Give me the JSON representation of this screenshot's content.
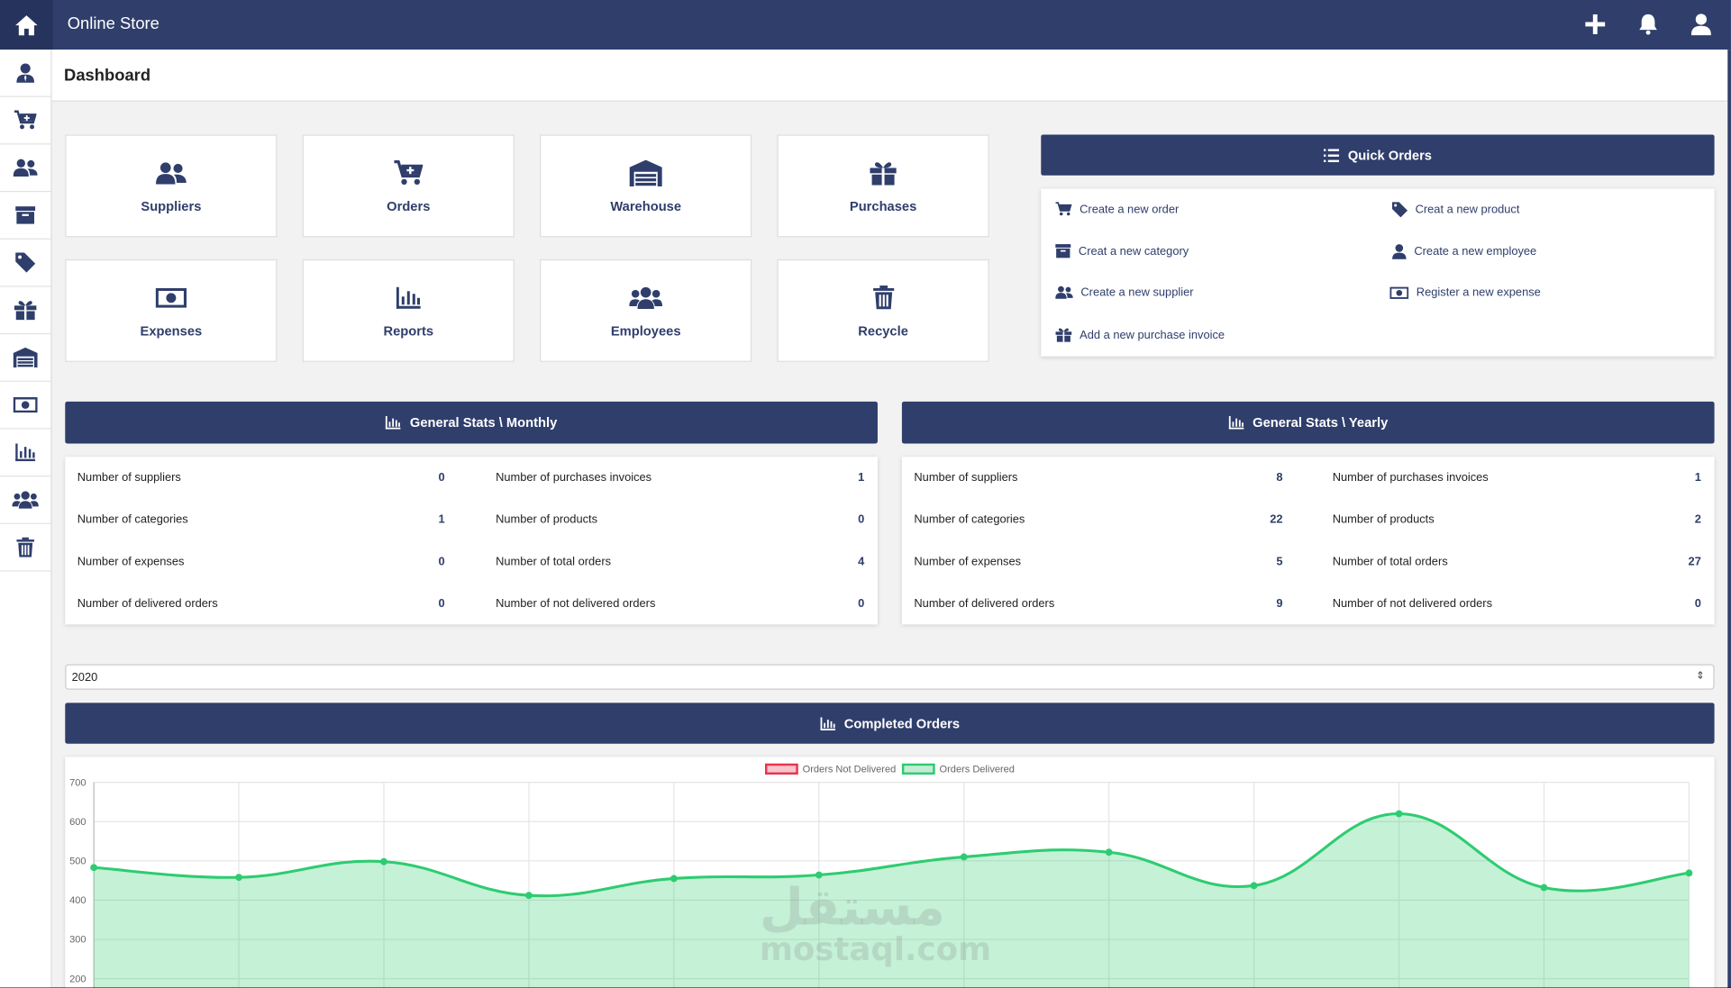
{
  "app": {
    "title": "Online Store"
  },
  "page": {
    "title": "Dashboard"
  },
  "tiles": [
    {
      "label": "Suppliers",
      "icon": "users-icon"
    },
    {
      "label": "Orders",
      "icon": "cart-plus-icon"
    },
    {
      "label": "Warehouse",
      "icon": "warehouse-icon"
    },
    {
      "label": "Purchases",
      "icon": "gift-icon"
    },
    {
      "label": "Expenses",
      "icon": "money-bill-icon"
    },
    {
      "label": "Reports",
      "icon": "chart-bar-icon"
    },
    {
      "label": "Employees",
      "icon": "users-group-icon"
    },
    {
      "label": "Recycle",
      "icon": "trash-icon"
    }
  ],
  "quick_orders": {
    "title": "Quick Orders",
    "items": [
      {
        "label": "Create a new order",
        "icon": "cart-plus-icon"
      },
      {
        "label": "Creat a new product",
        "icon": "tag-icon"
      },
      {
        "label": "Creat a new category",
        "icon": "archive-icon"
      },
      {
        "label": "Create a new employee",
        "icon": "user-icon"
      },
      {
        "label": "Create a new supplier",
        "icon": "users-icon"
      },
      {
        "label": "Register a new expense",
        "icon": "money-bill-icon"
      },
      {
        "label": "Add a new purchase invoice",
        "icon": "gift-icon"
      }
    ]
  },
  "stats_monthly": {
    "title": "General Stats \\ Monthly",
    "rows": [
      {
        "label": "Number of suppliers",
        "value": "0"
      },
      {
        "label": "Number of purchases invoices",
        "value": "1"
      },
      {
        "label": "Number of categories",
        "value": "1"
      },
      {
        "label": "Number of products",
        "value": "0"
      },
      {
        "label": "Number of expenses",
        "value": "0"
      },
      {
        "label": "Number of total orders",
        "value": "4"
      },
      {
        "label": "Number of delivered orders",
        "value": "0"
      },
      {
        "label": "Number of not delivered orders",
        "value": "0"
      }
    ]
  },
  "stats_yearly": {
    "title": "General Stats \\ Yearly",
    "rows": [
      {
        "label": "Number of suppliers",
        "value": "8"
      },
      {
        "label": "Number of purchases invoices",
        "value": "1"
      },
      {
        "label": "Number of categories",
        "value": "22"
      },
      {
        "label": "Number of products",
        "value": "2"
      },
      {
        "label": "Number of expenses",
        "value": "5"
      },
      {
        "label": "Number of total orders",
        "value": "27"
      },
      {
        "label": "Number of delivered orders",
        "value": "9"
      },
      {
        "label": "Number of not delivered orders",
        "value": "0"
      }
    ]
  },
  "year_select": {
    "value": "2020"
  },
  "completed_orders": {
    "title": "Completed Orders"
  },
  "watermark": {
    "arabic": "مستقل",
    "latin": "mostaql.com"
  },
  "colors": {
    "primary": "#2f3e6b",
    "delivered": "#2ecc71",
    "not_delivered": "#e8354f"
  },
  "chart_data": {
    "type": "area",
    "y_ticks": [
      "700",
      "600",
      "500",
      "400",
      "300",
      "200"
    ],
    "ylim": [
      200,
      700
    ],
    "legend": {
      "position": "top-center"
    },
    "grid": true,
    "series": [
      {
        "name": "Orders Not Delivered",
        "values": []
      },
      {
        "name": "Orders Delivered",
        "values": [
          483,
          458,
          498,
          412,
          455,
          464,
          510,
          522,
          437,
          620,
          432,
          469
        ]
      }
    ]
  }
}
